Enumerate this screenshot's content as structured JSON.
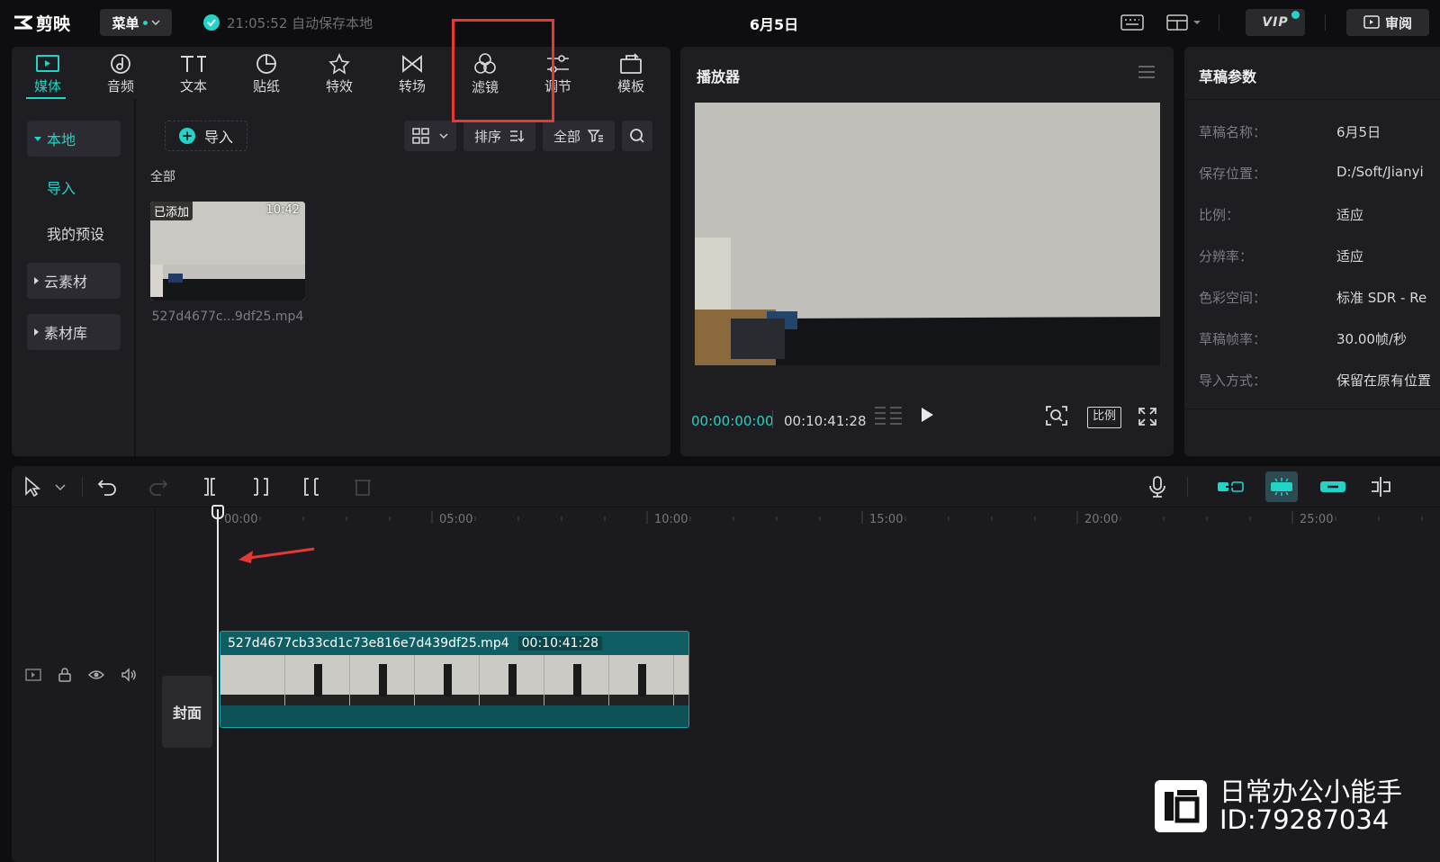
{
  "app": {
    "name": "剪映",
    "menu_label": "菜单",
    "autosave_text": "21:05:52 自动保存本地",
    "project_title": "6月5日",
    "vip_label": "VIP",
    "review_label": "审阅"
  },
  "toolbar": {
    "tools": [
      {
        "label": "媒体",
        "icon": "media-icon",
        "active": true
      },
      {
        "label": "音频",
        "icon": "audio-icon"
      },
      {
        "label": "文本",
        "icon": "text-icon"
      },
      {
        "label": "贴纸",
        "icon": "sticker-icon"
      },
      {
        "label": "特效",
        "icon": "effects-icon"
      },
      {
        "label": "转场",
        "icon": "transition-icon"
      },
      {
        "label": "滤镜",
        "icon": "filter-icon"
      },
      {
        "label": "调节",
        "icon": "adjust-icon"
      },
      {
        "label": "模板",
        "icon": "template-icon"
      }
    ]
  },
  "media": {
    "nav": {
      "local": "本地",
      "import": "导入",
      "presets": "我的预设",
      "cloud": "云素材",
      "library": "素材库"
    },
    "import_button": "导入",
    "sort_label": "排序",
    "filter_label": "全部",
    "section_label": "全部",
    "items": [
      {
        "badge": "已添加",
        "duration": "10:42",
        "name": "527d4677c...9df25.mp4"
      }
    ]
  },
  "player": {
    "title": "播放器",
    "current_time": "00:00:00:00",
    "total_time": "00:10:41:28",
    "ratio_label": "比例"
  },
  "params": {
    "title": "草稿参数",
    "rows": [
      {
        "label": "草稿名称：",
        "value": "6月5日"
      },
      {
        "label": "保存位置：",
        "value": "D:/Soft/Jianyi"
      },
      {
        "label": "比例：",
        "value": "适应"
      },
      {
        "label": "分辨率：",
        "value": "适应"
      },
      {
        "label": "色彩空间：",
        "value": "标准 SDR - Re"
      },
      {
        "label": "草稿帧率：",
        "value": "30.00帧/秒"
      },
      {
        "label": "导入方式：",
        "value": "保留在原有位置"
      }
    ]
  },
  "timeline": {
    "ruler": [
      "00:00",
      "05:00",
      "10:00",
      "15:00",
      "20:00",
      "25:00"
    ],
    "cover_label": "封面",
    "clip": {
      "name": "527d4677cb33cd1c73e816e7d439df25.mp4",
      "duration": "00:10:41:28"
    }
  },
  "watermark": {
    "line1": "日常办公小能手",
    "line2": "ID:79287034"
  },
  "colors": {
    "accent": "#22d3c8",
    "highlight_box": "#e53935",
    "background": "#0e0e10",
    "panel": "#1e1e22"
  }
}
